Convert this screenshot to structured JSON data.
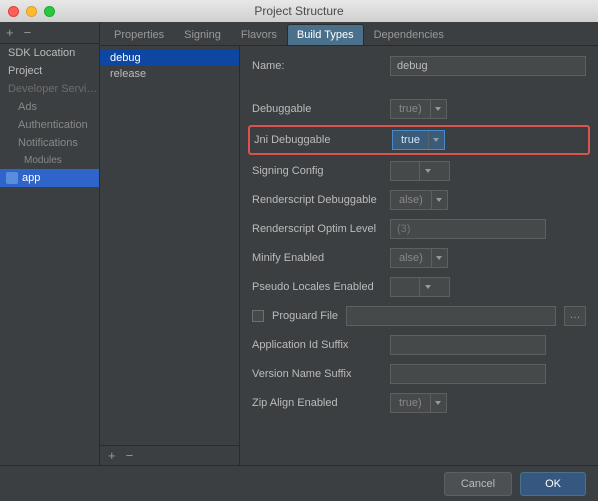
{
  "window": {
    "title": "Project Structure"
  },
  "sidebar": {
    "items": [
      {
        "label": "SDK Location",
        "cls": ""
      },
      {
        "label": "Project",
        "cls": ""
      },
      {
        "label": "Developer Servi…",
        "cls": "dim"
      },
      {
        "label": "Ads",
        "cls": "sub"
      },
      {
        "label": "Authentication",
        "cls": "sub"
      },
      {
        "label": "Notifications",
        "cls": "sub"
      },
      {
        "label": "Modules",
        "cls": "mod"
      },
      {
        "label": "app",
        "cls": "sel"
      }
    ]
  },
  "tabs": [
    "Properties",
    "Signing",
    "Flavors",
    "Build Types",
    "Dependencies"
  ],
  "active_tab": "Build Types",
  "build_types": [
    "debug",
    "release"
  ],
  "selected_bt": "debug",
  "form": {
    "name": {
      "label": "Name:",
      "value": "debug"
    },
    "debuggable": {
      "label": "Debuggable",
      "value": "true)"
    },
    "jni": {
      "label": "Jni Debuggable",
      "value": "true"
    },
    "signing": {
      "label": "Signing Config",
      "value": ""
    },
    "rsdbg": {
      "label": "Renderscript Debuggable",
      "value": "alse)"
    },
    "rsopt": {
      "label": "Renderscript Optim Level",
      "value": "(3)"
    },
    "minify": {
      "label": "Minify Enabled",
      "value": "alse)"
    },
    "pseudo": {
      "label": "Pseudo Locales Enabled",
      "value": ""
    },
    "proguard": {
      "label": "Proguard File",
      "value": ""
    },
    "appid": {
      "label": "Application Id Suffix",
      "value": ""
    },
    "version": {
      "label": "Version Name Suffix",
      "value": ""
    },
    "zip": {
      "label": "Zip Align Enabled",
      "value": "true)"
    }
  },
  "footer": {
    "cancel": "Cancel",
    "ok": "OK"
  }
}
